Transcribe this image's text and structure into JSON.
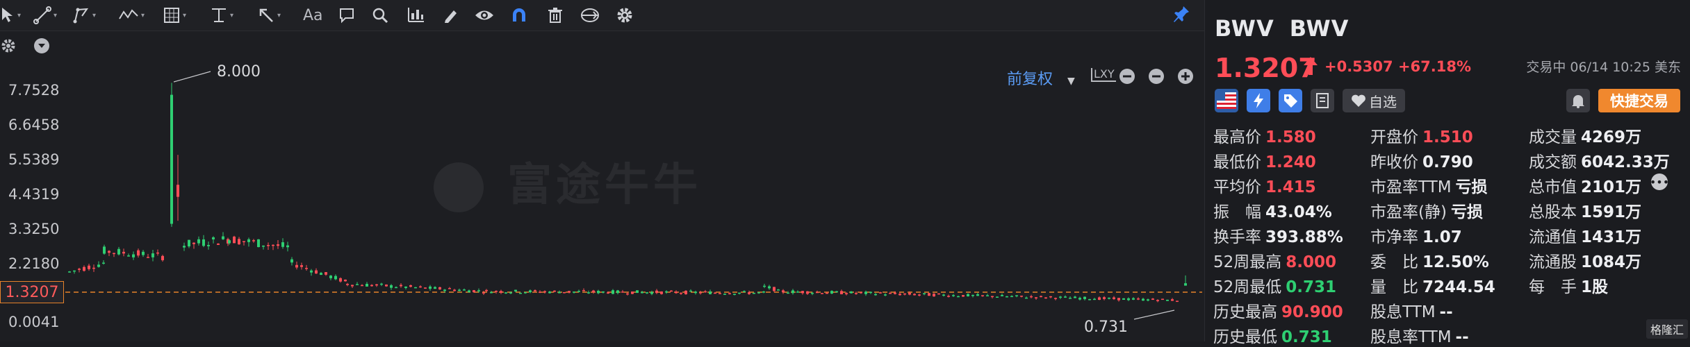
{
  "toolbar": {
    "tools": [
      "cursor-tool",
      "line-tool",
      "path-tool",
      "wave-tool",
      "grid-tool",
      "level-tool",
      "arrow-tool",
      "text-tool",
      "comment-tool",
      "search-tool",
      "indicator-tool",
      "pen-tool",
      "eye-tool",
      "magnet-tool",
      "trash-tool",
      "layers-tool",
      "settings-tool"
    ],
    "text_tool_label": "Aa",
    "adjust_mode": "前复权",
    "scale_label": "LXY"
  },
  "chart": {
    "y_labels": [
      "7.7528",
      "6.6458",
      "5.5389",
      "4.4319",
      "3.3250",
      "2.2180",
      "1.3207",
      "0.0041"
    ],
    "current_price_tag": "1.3207",
    "high_annotation": "8.000",
    "low_annotation": "0.731",
    "watermark": "富途牛牛",
    "colors": {
      "up": "#2ecf72",
      "down": "#ff4d57",
      "current_line": "#e8832a"
    }
  },
  "quote": {
    "symbol": "BWV",
    "name": "BWV",
    "price": "1.3207",
    "change": "+0.5307",
    "change_pct": "+67.18%",
    "status_time": "交易中 06/14 10:25 美东",
    "watch_label": "自选",
    "trade_label": "快捷交易",
    "stats": [
      {
        "k": "最高价",
        "v": "1.580",
        "c": "red"
      },
      {
        "k": "开盘价",
        "v": "1.510",
        "c": "red"
      },
      {
        "k": "成交量",
        "v": "4269万",
        "c": "white"
      },
      {
        "k": "最低价",
        "v": "1.240",
        "c": "red"
      },
      {
        "k": "昨收价",
        "v": "0.790",
        "c": "white"
      },
      {
        "k": "成交额",
        "v": "6042.33万",
        "c": "white"
      },
      {
        "k": "平均价",
        "v": "1.415",
        "c": "red"
      },
      {
        "k": "市盈率TTM",
        "v": "亏损",
        "c": "white"
      },
      {
        "k": "总市值",
        "v": "2101万",
        "c": "white"
      },
      {
        "k": "振　幅",
        "v": "43.04%",
        "c": "white"
      },
      {
        "k": "市盈率(静)",
        "v": "亏损",
        "c": "white"
      },
      {
        "k": "总股本",
        "v": "1591万",
        "c": "white"
      },
      {
        "k": "换手率",
        "v": "393.88%",
        "c": "white"
      },
      {
        "k": "市净率",
        "v": "1.07",
        "c": "white"
      },
      {
        "k": "流通值",
        "v": "1431万",
        "c": "white"
      },
      {
        "k": "52周最高",
        "v": "8.000",
        "c": "red"
      },
      {
        "k": "委　比",
        "v": "12.50%",
        "c": "white"
      },
      {
        "k": "流通股",
        "v": "1084万",
        "c": "white"
      },
      {
        "k": "52周最低",
        "v": "0.731",
        "c": "green"
      },
      {
        "k": "量　比",
        "v": "7244.54",
        "c": "white"
      },
      {
        "k": "每　手",
        "v": "1股",
        "c": "white"
      },
      {
        "k": "历史最高",
        "v": "90.900",
        "c": "red"
      },
      {
        "k": "股息TTM",
        "v": "--",
        "c": "white"
      },
      {
        "k": "历史最低",
        "v": "0.731",
        "c": "green"
      },
      {
        "k": "股息率TTM",
        "v": "--",
        "c": "white"
      }
    ],
    "footer": "格隆汇"
  }
}
